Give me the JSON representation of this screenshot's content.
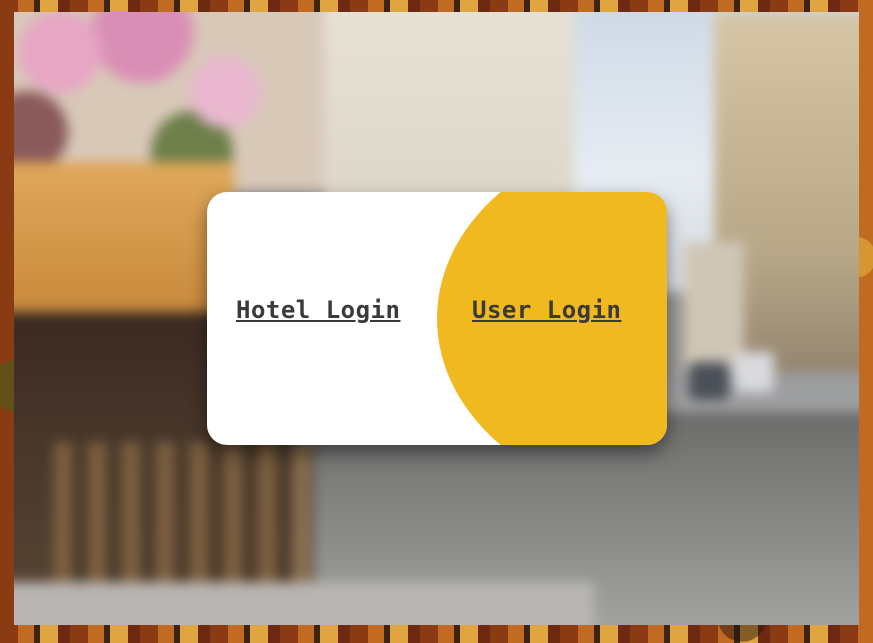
{
  "login_options": {
    "hotel_login_label": "Hotel Login",
    "user_login_label": "User Login"
  },
  "colors": {
    "accent": "#f1b920",
    "card_background": "#ffffff",
    "link_text": "#3a3a3a"
  }
}
